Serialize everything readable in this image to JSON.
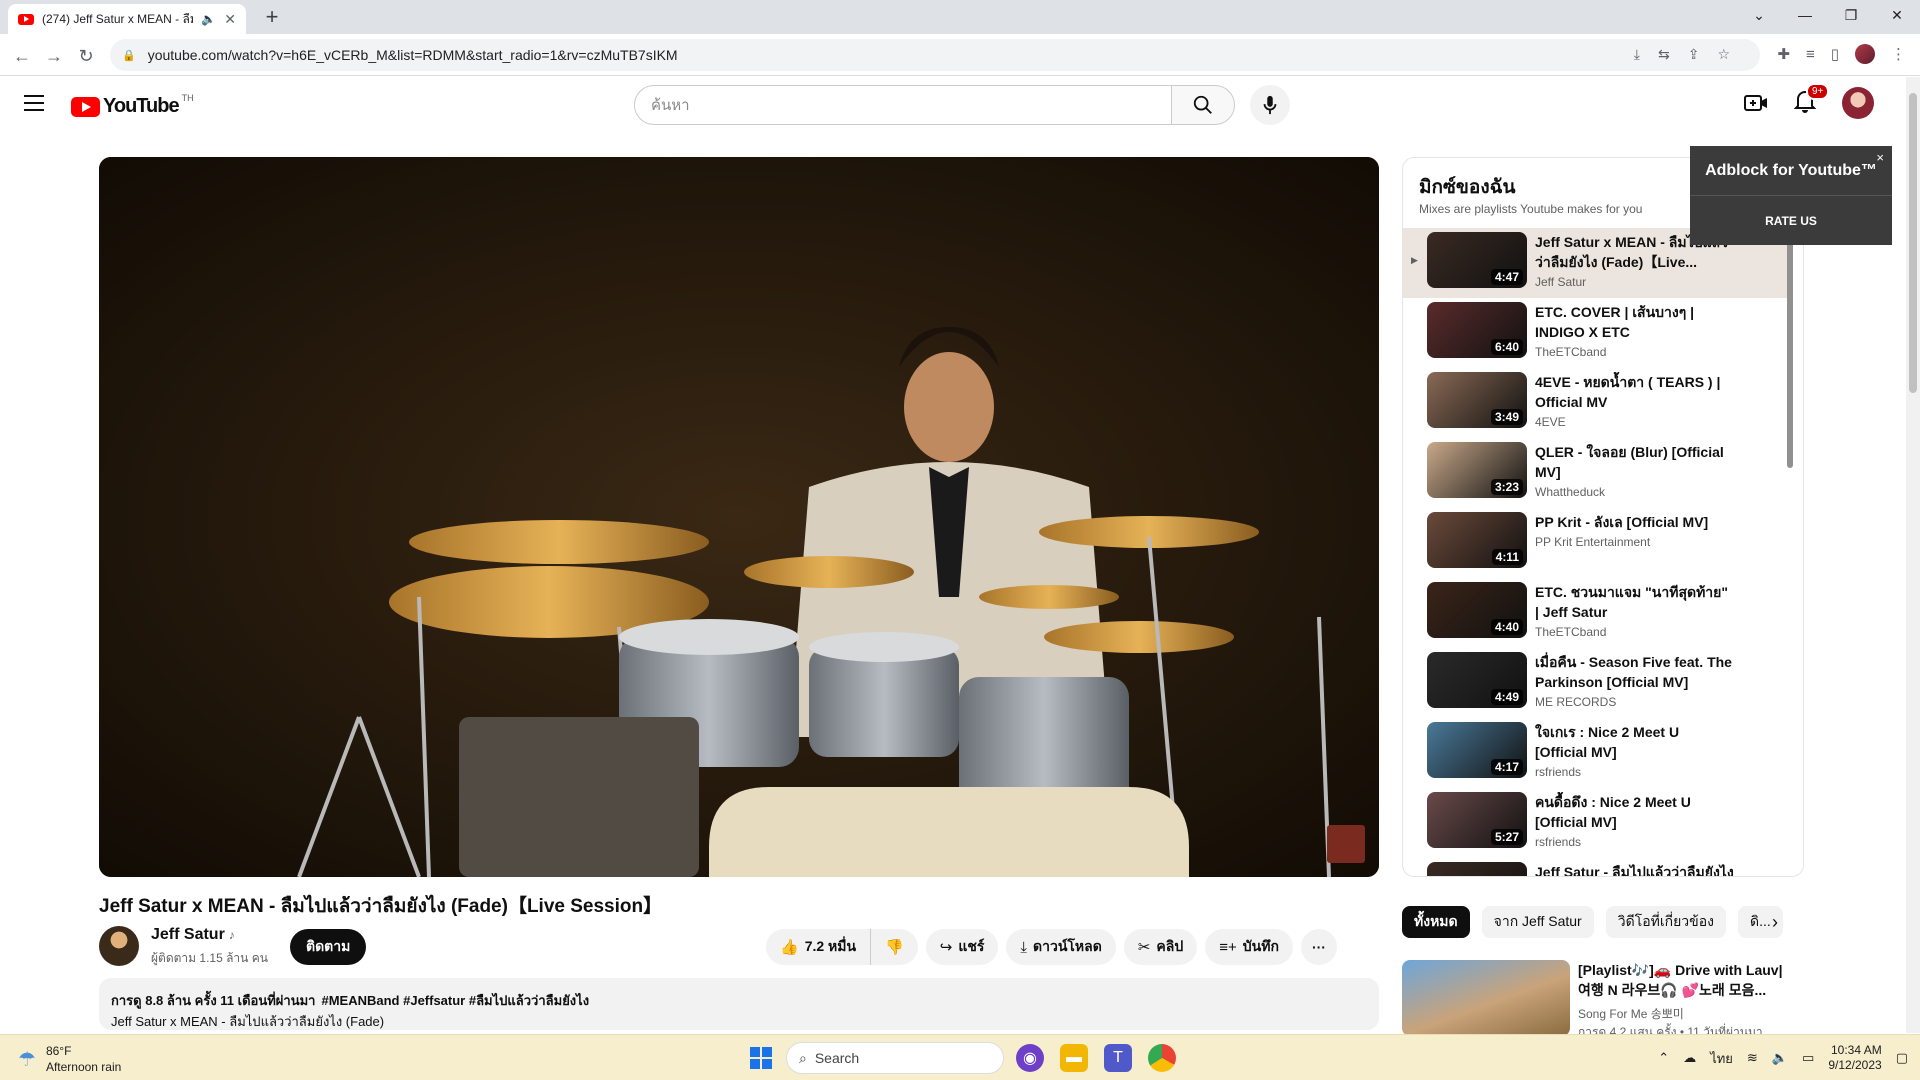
{
  "browser": {
    "tab_title": "(274) Jeff Satur x MEAN - ลืมไ",
    "url": "youtube.com/watch?v=h6E_vCERb_M&list=RDMM&start_radio=1&rv=czMuTB7sIKM",
    "new_tab": "+"
  },
  "header": {
    "logo_word": "YouTube",
    "logo_country": "TH",
    "search_placeholder": "ค้นหา",
    "notif_count": "9+"
  },
  "video": {
    "title": "Jeff Satur x MEAN - ลืมไปแล้วว่าลืมยังไง (Fade)【Live Session】",
    "channel": "Jeff Satur",
    "subscribers": "ผู้ติดตาม 1.15 ล้าน คน",
    "subscribe_label": "ติดตาม",
    "likes": "7.2 หมื่น",
    "share_label": "แชร์",
    "download_label": "ดาวน์โหลด",
    "clip_label": "คลิป",
    "save_label": "บันทึก",
    "more_label": "···",
    "desc_meta": "การดู 8.8 ล้าน ครั้ง  11 เดือนที่ผ่านมา",
    "desc_tags": "#MEANBand #Jeffsatur #ลืมไปแล้วว่าลืมยังไง",
    "desc_line2": "Jeff Satur x MEAN - ลืมไปแล้วว่าลืมยังไง (Fade)"
  },
  "playlist": {
    "title": "มิกซ์ของฉัน",
    "subtitle": "Mixes are playlists Youtube makes for you",
    "items": [
      {
        "title": "Jeff Satur x MEAN - ลืมไปแล้วว่าลืมยังไง (Fade)【Live...",
        "channel": "Jeff Satur",
        "duration": "4:47",
        "color": "#3a2a22"
      },
      {
        "title": "ETC. COVER | เส้นบางๆ | INDIGO X ETC",
        "channel": "TheETCband",
        "duration": "6:40",
        "color": "#5a2b2b"
      },
      {
        "title": "4EVE - หยดน้ำตา ( TEARS ) | Official MV",
        "channel": "4EVE",
        "duration": "3:49",
        "color": "#8a6a55"
      },
      {
        "title": "QLER - ใจลอย (Blur) [Official MV]",
        "channel": "Whattheduck",
        "duration": "3:23",
        "color": "#c9a98a"
      },
      {
        "title": "PP Krit - ลังเล [Official MV]",
        "channel": "PP Krit Entertainment",
        "duration": "4:11",
        "color": "#6b4a3a"
      },
      {
        "title": "ETC. ชวนมาแจม \"นาทีสุดท้าย\" | Jeff Satur",
        "channel": "TheETCband",
        "duration": "4:40",
        "color": "#3b2418"
      },
      {
        "title": "เมื่อคืน - Season Five feat. The Parkinson [Official MV]",
        "channel": "ME RECORDS",
        "duration": "4:49",
        "color": "#2a2a2a"
      },
      {
        "title": "ใจเกเร : Nice 2 Meet U [Official MV]",
        "channel": "rsfriends",
        "duration": "4:17",
        "color": "#4a7a9a"
      },
      {
        "title": "คนดื้อดึง : Nice 2 Meet U [Official MV]",
        "channel": "rsfriends",
        "duration": "5:27",
        "color": "#6a4a4a"
      },
      {
        "title": "Jeff Satur - ลืมไปแล้วว่าลืมยังไง",
        "channel": "",
        "duration": "",
        "color": "#3a2a22"
      }
    ]
  },
  "adblock": {
    "title": "Adblock for Youtube™",
    "rate": "RATE US",
    "close": "×"
  },
  "chips": [
    "ทั้งหมด",
    "จาก Jeff Satur",
    "วิดีโอที่เกี่ยวข้อง",
    "ดิ..."
  ],
  "related": {
    "title": "[Playlist🎶]🚗 Drive with Lauv| 여행 N 라우브🎧 💕노래 모음...",
    "channel": "Song For Me 송뽀미",
    "meta": "การดู 4.2 แสน ครั้ง • 11 วันที่ผ่านมา"
  },
  "taskbar": {
    "temp": "86°F",
    "weather": "Afternoon rain",
    "search": "Search",
    "lang": "ไทย",
    "time": "10:34 AM",
    "date": "9/12/2023"
  }
}
